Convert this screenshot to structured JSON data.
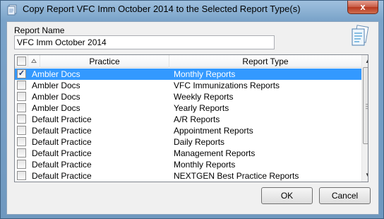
{
  "window": {
    "title": "Copy Report VFC Imm October 2014 to the Selected Report Type(s)",
    "close_label": "x"
  },
  "form": {
    "report_name_label": "Report Name",
    "report_name_value": "VFC Imm October 2014"
  },
  "grid": {
    "columns": [
      "Practice",
      "Report Type"
    ],
    "rows": [
      {
        "checked": true,
        "selected": true,
        "practice": "Ambler Docs",
        "report_type": "Monthly Reports"
      },
      {
        "checked": false,
        "selected": false,
        "practice": "Ambler Docs",
        "report_type": "VFC Immunizations Reports"
      },
      {
        "checked": false,
        "selected": false,
        "practice": "Ambler Docs",
        "report_type": "Weekly Reports"
      },
      {
        "checked": false,
        "selected": false,
        "practice": "Ambler Docs",
        "report_type": "Yearly Reports"
      },
      {
        "checked": false,
        "selected": false,
        "practice": "Default Practice",
        "report_type": "A/R Reports"
      },
      {
        "checked": false,
        "selected": false,
        "practice": "Default Practice",
        "report_type": "Appointment Reports"
      },
      {
        "checked": false,
        "selected": false,
        "practice": "Default Practice",
        "report_type": "Daily Reports"
      },
      {
        "checked": false,
        "selected": false,
        "practice": "Default Practice",
        "report_type": "Management Reports"
      },
      {
        "checked": false,
        "selected": false,
        "practice": "Default Practice",
        "report_type": "Monthly Reports"
      },
      {
        "checked": false,
        "selected": false,
        "practice": "Default Practice",
        "report_type": "NEXTGEN Best Practice Reports"
      }
    ]
  },
  "buttons": {
    "ok": "OK",
    "cancel": "Cancel"
  },
  "colors": {
    "selection": "#3399ff",
    "title_bar": "#9fc0de"
  }
}
